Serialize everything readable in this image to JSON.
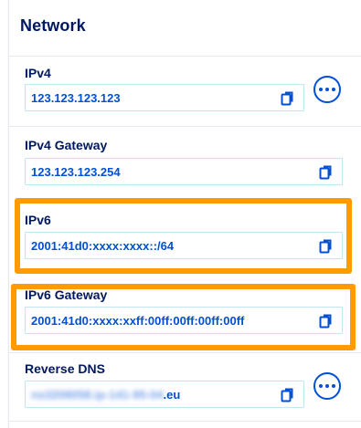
{
  "card": {
    "title": "Network"
  },
  "rows": [
    {
      "label": "IPv4",
      "value": "123.123.123.123",
      "copy_icon": "copy-icon",
      "has_more": true
    },
    {
      "label": "IPv4 Gateway",
      "value": "123.123.123.254",
      "copy_icon": "copy-icon",
      "has_more": false
    },
    {
      "label": "IPv6",
      "value": "2001:41d0:xxxx:xxxx::/64",
      "copy_icon": "copy-icon",
      "has_more": false
    },
    {
      "label": "IPv6 Gateway",
      "value": "2001:41d0:xxxx:xxff:00ff:00ff:00ff:00ff",
      "copy_icon": "copy-icon",
      "has_more": false
    },
    {
      "label": "Reverse DNS",
      "value_blurred": "ns3208058.ip-141-95-04",
      "value_suffix": ".eu",
      "copy_icon": "copy-icon",
      "has_more": true
    }
  ],
  "more_icon": "ellipsis-icon",
  "colors": {
    "title": "#00185e",
    "value_text": "#0050d7",
    "field_border": "#bfe8f5",
    "divider": "#e6e9f2",
    "highlight": "#ff9a00"
  }
}
